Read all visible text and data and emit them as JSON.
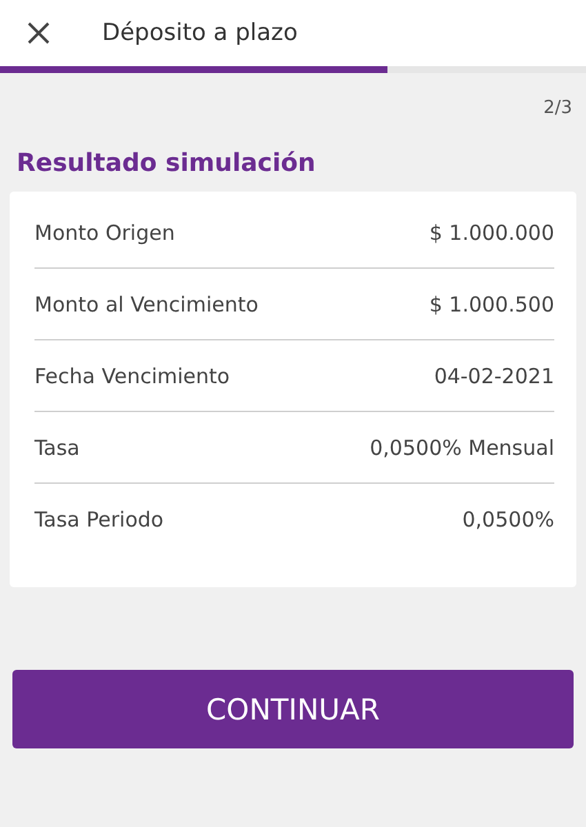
{
  "header": {
    "title": "Déposito a plazo"
  },
  "progress": {
    "level": 0.66
  },
  "step": "2/3",
  "section_title": "Resultado simulación",
  "rows": [
    {
      "label": "Monto Origen",
      "value": "$ 1.000.000"
    },
    {
      "label": "Monto al Vencimiento",
      "value": "$ 1.000.500"
    },
    {
      "label": "Fecha Vencimiento",
      "value": "04-02-2021"
    },
    {
      "label": "Tasa",
      "value": "0,0500% Mensual"
    },
    {
      "label": "Tasa Periodo",
      "value": "0,0500%"
    }
  ],
  "button": "CONTINUAR"
}
